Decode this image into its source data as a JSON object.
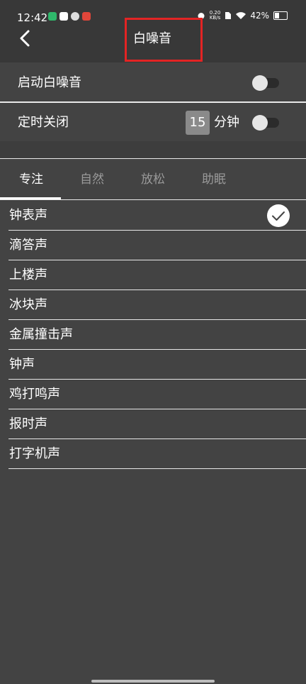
{
  "status_bar": {
    "time": "12:42",
    "net_speed_value": "0.20",
    "net_speed_unit": "KB/s",
    "battery": "42%"
  },
  "header": {
    "title": "白噪音"
  },
  "settings": {
    "enable_label": "启动白噪音",
    "enable_on": false,
    "timer_label": "定时关闭",
    "timer_value": "15",
    "timer_unit": "分钟",
    "timer_on": false
  },
  "tabs": [
    {
      "label": "专注",
      "active": true
    },
    {
      "label": "自然",
      "active": false
    },
    {
      "label": "放松",
      "active": false
    },
    {
      "label": "助眠",
      "active": false
    }
  ],
  "sounds": [
    {
      "label": "钟表声",
      "selected": true
    },
    {
      "label": "滴答声",
      "selected": false
    },
    {
      "label": "上楼声",
      "selected": false
    },
    {
      "label": "冰块声",
      "selected": false
    },
    {
      "label": "金属撞击声",
      "selected": false
    },
    {
      "label": "钟声",
      "selected": false
    },
    {
      "label": "鸡打鸣声",
      "selected": false
    },
    {
      "label": "报时声",
      "selected": false
    },
    {
      "label": "打字机声",
      "selected": false
    }
  ],
  "colors": {
    "background": "#434343",
    "header": "#383838",
    "highlight_box": "#e32424",
    "inactive_tab": "#9a9a9a"
  }
}
